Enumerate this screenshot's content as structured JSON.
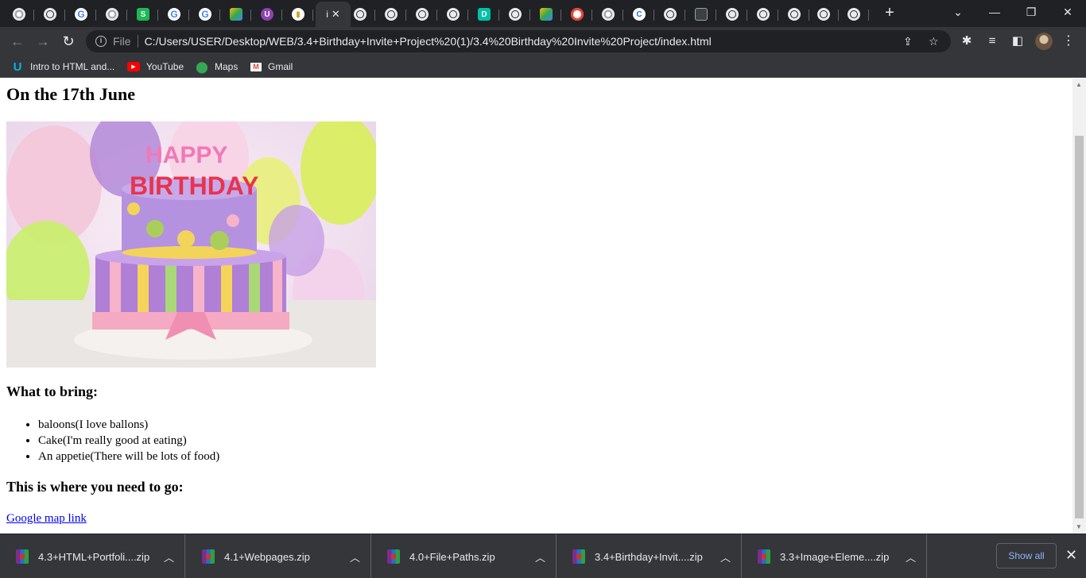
{
  "browser": {
    "active_tab_title": "i",
    "new_tab_label": "+",
    "window_controls": {
      "dropdown": "⌄",
      "minimize": "—",
      "restore": "❐",
      "close": "✕"
    },
    "address": {
      "scheme": "File",
      "url": "C:/Users/USER/Desktop/WEB/3.4+Birthday+Invite+Project%20(1)/3.4%20Birthday%20Invite%20Project/index.html"
    },
    "bookmarks": [
      {
        "label": "Intro to HTML and...",
        "icon": "udacity-icon"
      },
      {
        "label": "YouTube",
        "icon": "youtube-icon"
      },
      {
        "label": "Maps",
        "icon": "maps-icon"
      },
      {
        "label": "Gmail",
        "icon": "gmail-icon"
      }
    ],
    "colors": {
      "frame": "#202124",
      "toolbar": "#35363a",
      "link": "#0000ee",
      "accent_link": "#8ab4f8"
    }
  },
  "page": {
    "heading": "On the 17th June",
    "bring_heading": "What to bring:",
    "bring_items": [
      "baloons(I love ballons)",
      "Cake(I'm really good at eating)",
      "An appetie(There will be lots of food)"
    ],
    "where_heading": "This is where you need to go:",
    "map_link": "Google map link"
  },
  "downloads": {
    "items": [
      "4.3+HTML+Portfoli....zip",
      "4.1+Webpages.zip",
      "4.0+File+Paths.zip",
      "3.4+Birthday+Invit....zip",
      "3.3+Image+Eleme....zip"
    ],
    "show_all": "Show all",
    "close": "✕"
  }
}
